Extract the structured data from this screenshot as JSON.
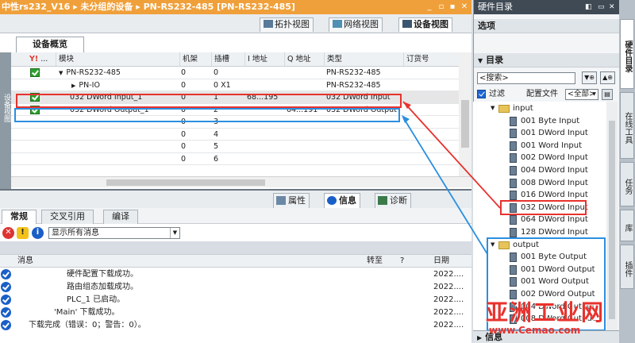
{
  "title": "中性rs232_V16 ▸ 未分组的设备 ▸ PN-RS232-485 [PN-RS232-485]",
  "window_controls": [
    "_",
    "▫",
    "▪",
    "✕"
  ],
  "view_tabs": [
    {
      "label": "拓扑视图"
    },
    {
      "label": "网络视图"
    },
    {
      "label": "设备视图"
    }
  ],
  "device_overview": {
    "tab_label": "设备概览",
    "sidebar_label": "设备视图",
    "columns": [
      "模块",
      "机架",
      "插槽",
      "I 地址",
      "Q 地址",
      "类型",
      "订货号"
    ],
    "rows": [
      {
        "module": "PN-RS232-485",
        "rack": "0",
        "slot": "0",
        "i_addr": "",
        "q_addr": "",
        "type": "PN-RS232-485"
      },
      {
        "module": "PN-IO",
        "rack": "0",
        "slot": "0 X1",
        "i_addr": "",
        "q_addr": "",
        "type": "PN-RS232-485"
      },
      {
        "module": "032 DWord Input_1",
        "rack": "0",
        "slot": "1",
        "i_addr": "68...195",
        "q_addr": "",
        "type": "032 DWord Input"
      },
      {
        "module": "032 DWord Output_1",
        "rack": "0",
        "slot": "2",
        "i_addr": "",
        "q_addr": "64...191",
        "type": "032 DWord Output"
      },
      {
        "module": "",
        "rack": "0",
        "slot": "3",
        "i_addr": "",
        "q_addr": "",
        "type": ""
      },
      {
        "module": "",
        "rack": "0",
        "slot": "4",
        "i_addr": "",
        "q_addr": "",
        "type": ""
      },
      {
        "module": "",
        "rack": "0",
        "slot": "5",
        "i_addr": "",
        "q_addr": "",
        "type": ""
      },
      {
        "module": "",
        "rack": "0",
        "slot": "6",
        "i_addr": "",
        "q_addr": "",
        "type": ""
      }
    ]
  },
  "inspector": {
    "tabs": [
      {
        "label": "属性"
      },
      {
        "label": "信息"
      },
      {
        "label": "诊断"
      }
    ],
    "subtabs": [
      "常规",
      "交叉引用",
      "编译"
    ],
    "filter_value": "显示所有消息",
    "msg_columns": [
      "消息",
      "转至",
      "?",
      "日期"
    ],
    "messages": [
      {
        "text": "硬件配置下载成功。",
        "date": "2022...."
      },
      {
        "text": "路由组态加载成功。",
        "date": "2022...."
      },
      {
        "text": "PLC_1 已启动。",
        "date": "2022...."
      },
      {
        "text": "'Main' 下载成功。",
        "date": "2022...."
      },
      {
        "text": "下载完成（错误：0；警告：0）。",
        "date": "2022...."
      }
    ]
  },
  "catalog": {
    "title": "硬件目录",
    "options_label": "选项",
    "catalog_label": "目录",
    "search_placeholder": "<搜索>",
    "filter_label": "过滤",
    "profile_label": "配置文件",
    "profile_value": "<全部>",
    "tree": [
      {
        "label": "input",
        "type": "folder"
      },
      {
        "label": "001 Byte Input"
      },
      {
        "label": "001 DWord Input"
      },
      {
        "label": "001 Word Input"
      },
      {
        "label": "002 DWord Input"
      },
      {
        "label": "004 DWord Input"
      },
      {
        "label": "008 DWord Input"
      },
      {
        "label": "016 DWord Input"
      },
      {
        "label": "032 DWord Input"
      },
      {
        "label": "064 DWord Input"
      },
      {
        "label": "128 DWord Input"
      },
      {
        "label": "output",
        "type": "folder"
      },
      {
        "label": "001 Byte Output"
      },
      {
        "label": "001 DWord Output"
      },
      {
        "label": "001 Word Output"
      },
      {
        "label": "002 DWord Output"
      },
      {
        "label": "004 DWord Output"
      },
      {
        "label": "008 DWord Output"
      }
    ],
    "info_label": "信息"
  },
  "side_tabs": [
    "硬件目录",
    "在线工具",
    "任务",
    "库",
    "插件"
  ],
  "watermark": {
    "main": "亚洲工业网",
    "url": "www.Cemao.com"
  },
  "colors": {
    "title_orange": "#f0a03a",
    "highlight_red": "#e8322d",
    "highlight_blue": "#2b8fe0",
    "ok_green": "#2fa02f"
  }
}
